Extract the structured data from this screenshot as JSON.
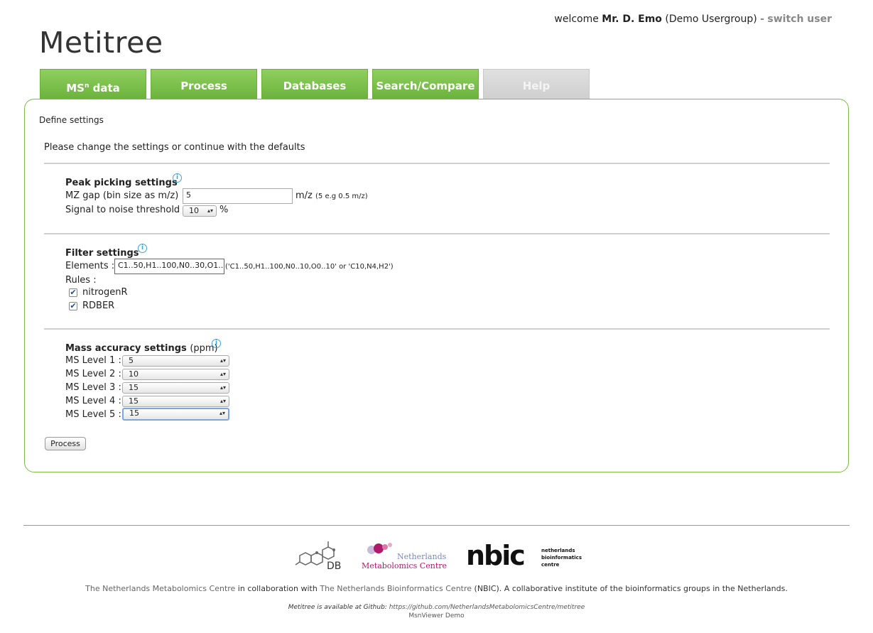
{
  "header": {
    "welcome_prefix": "welcome",
    "user_name": "Mr. D. Emo",
    "user_group": "(Demo Usergroup)",
    "separator": "-",
    "switch_user": "switch user"
  },
  "app": {
    "title": "Metitree"
  },
  "tabs": [
    {
      "label": "MS",
      "sup": "n",
      "suffix": " data",
      "active": true
    },
    {
      "label": "Process",
      "active": true
    },
    {
      "label": "Databases",
      "active": true
    },
    {
      "label": "Search/Compare",
      "active": true
    },
    {
      "label": "Help",
      "active": false
    }
  ],
  "panel": {
    "title": "Define settings",
    "intro": "Please change the settings or continue with the defaults"
  },
  "peak_picking": {
    "title": "Peak picking settings",
    "mz_gap_label": "MZ gap (bin size as m/z) :",
    "mz_gap_value": "5",
    "mz_gap_unit": "m/z",
    "mz_gap_hint": "(5 e.g 0.5 m/z)",
    "snr_label": "Signal to noise threshold :",
    "snr_value": "10",
    "snr_unit": "%"
  },
  "filter": {
    "title": "Filter settings",
    "elements_label": "Elements :",
    "elements_value": "C1..50,H1..100,N0..30,O1..",
    "elements_hint": "('C1..50,H1..100,N0..10,O0..10' or 'C10,N4,H2')",
    "rules_label": "Rules :",
    "rules": [
      {
        "label": "nitrogenR",
        "checked": true
      },
      {
        "label": "RDBER",
        "checked": true
      }
    ]
  },
  "mass_accuracy": {
    "title": "Mass accuracy settings",
    "unit": "(ppm)",
    "levels": [
      {
        "label": "MS Level 1 :",
        "value": "5"
      },
      {
        "label": "MS Level 2 :",
        "value": "10"
      },
      {
        "label": "MS Level 3 :",
        "value": "15"
      },
      {
        "label": "MS Level 4 :",
        "value": "15"
      },
      {
        "label": "MS Level 5 :",
        "value": "15"
      }
    ]
  },
  "actions": {
    "process_button": "Process"
  },
  "footer": {
    "nmc_line1": "Netherlands",
    "nmc_line2": "Metabolomics Centre",
    "db_logo_text": "DB",
    "nbic_word": "nbic",
    "nbic_desc_1": "netherlands",
    "nbic_desc_2": "bioinformatics",
    "nbic_desc_3": "centre",
    "collab_part1": "The Netherlands Metabolomics Centre",
    "collab_part2": " in collaboration with ",
    "collab_part3": "The Netherlands Bioinformatics Centre",
    "collab_part4": " (NBIC). A collaborative institute of the bioinformatics groups in the Netherlands.",
    "github_text": "Metitree is available at Github:",
    "github_url": "https://github.com/NetherlandsMetabolomicsCentre/metitree",
    "version": "MsnViewer Demo"
  },
  "colors": {
    "tab_green": "#6bb33c",
    "panel_border": "#7cbb46",
    "info_blue": "#3aa6d8",
    "tab_inactive": "#cfcfcf"
  }
}
